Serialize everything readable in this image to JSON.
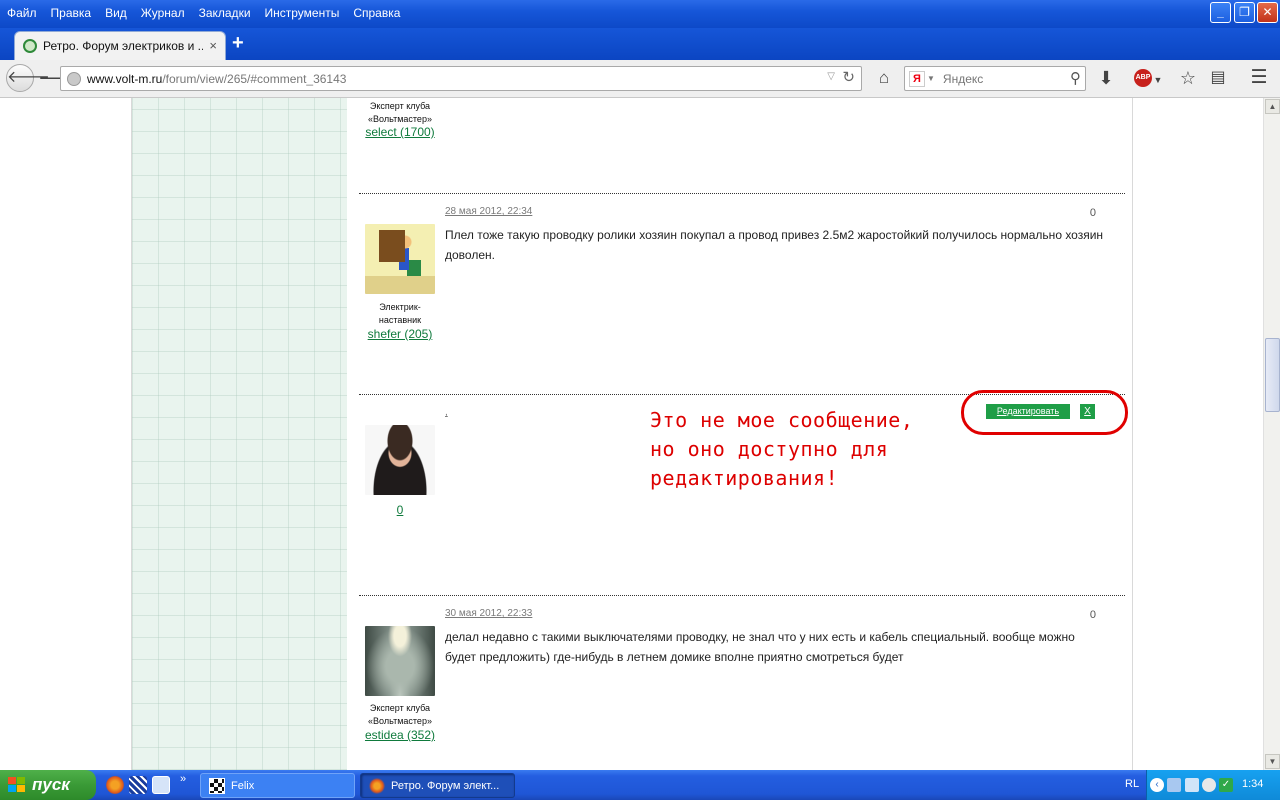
{
  "menubar": {
    "items": [
      "Файл",
      "Правка",
      "Вид",
      "Журнал",
      "Закладки",
      "Инструменты",
      "Справка"
    ]
  },
  "tab": {
    "title": "Ретро. Форум электриков и ...",
    "close": "×",
    "new_tab": "+"
  },
  "navbar": {
    "url_domain": "www.volt-m.ru",
    "url_path": "/forum/view/265/#comment_36143",
    "search_placeholder": "Яндекс",
    "search_engine_letter": "Я"
  },
  "posts": [
    {
      "rank_lines": [
        "Эксперт клуба",
        "«Вольтмастер»"
      ],
      "user": "select (1700)"
    },
    {
      "date": "28 мая 2012, 22:34",
      "rating": "0",
      "rank_lines": [
        "Электрик-",
        "наставник"
      ],
      "user": "shefer (205)",
      "text": "Плел тоже такую проводку ролики хозяин покупал а провод привез 2.5м2 жаростойкий получилось нормально хозяин доволен."
    },
    {
      "date": ",",
      "user": "0",
      "edit_label": "Редактировать",
      "delete_label": "X"
    },
    {
      "date": "30 мая 2012, 22:33",
      "rating": "0",
      "rank_lines": [
        "Эксперт клуба",
        "«Вольтмастер»"
      ],
      "user": "estidea (352)",
      "text": "делал недавно с такими выключателями проводку, не знал что у них есть и кабель специальный. вообще можно будет предложить) где-нибудь в летнем домике вполне приятно смотреться будет"
    }
  ],
  "annotation": {
    "lines": [
      "Это не мое сообщение,",
      "но оно доступно для",
      "редактирования!"
    ],
    "color": "#dd0000"
  },
  "taskbar": {
    "start_label": "пуск",
    "more": "»",
    "tasks": [
      "Felix",
      "Ретро. Форум элект..."
    ],
    "language": "RL",
    "clock": "1:34"
  },
  "colors": {
    "link_green": "#0f7a3c",
    "button_green": "#1f9e47",
    "xp_blue": "#245ee0"
  }
}
